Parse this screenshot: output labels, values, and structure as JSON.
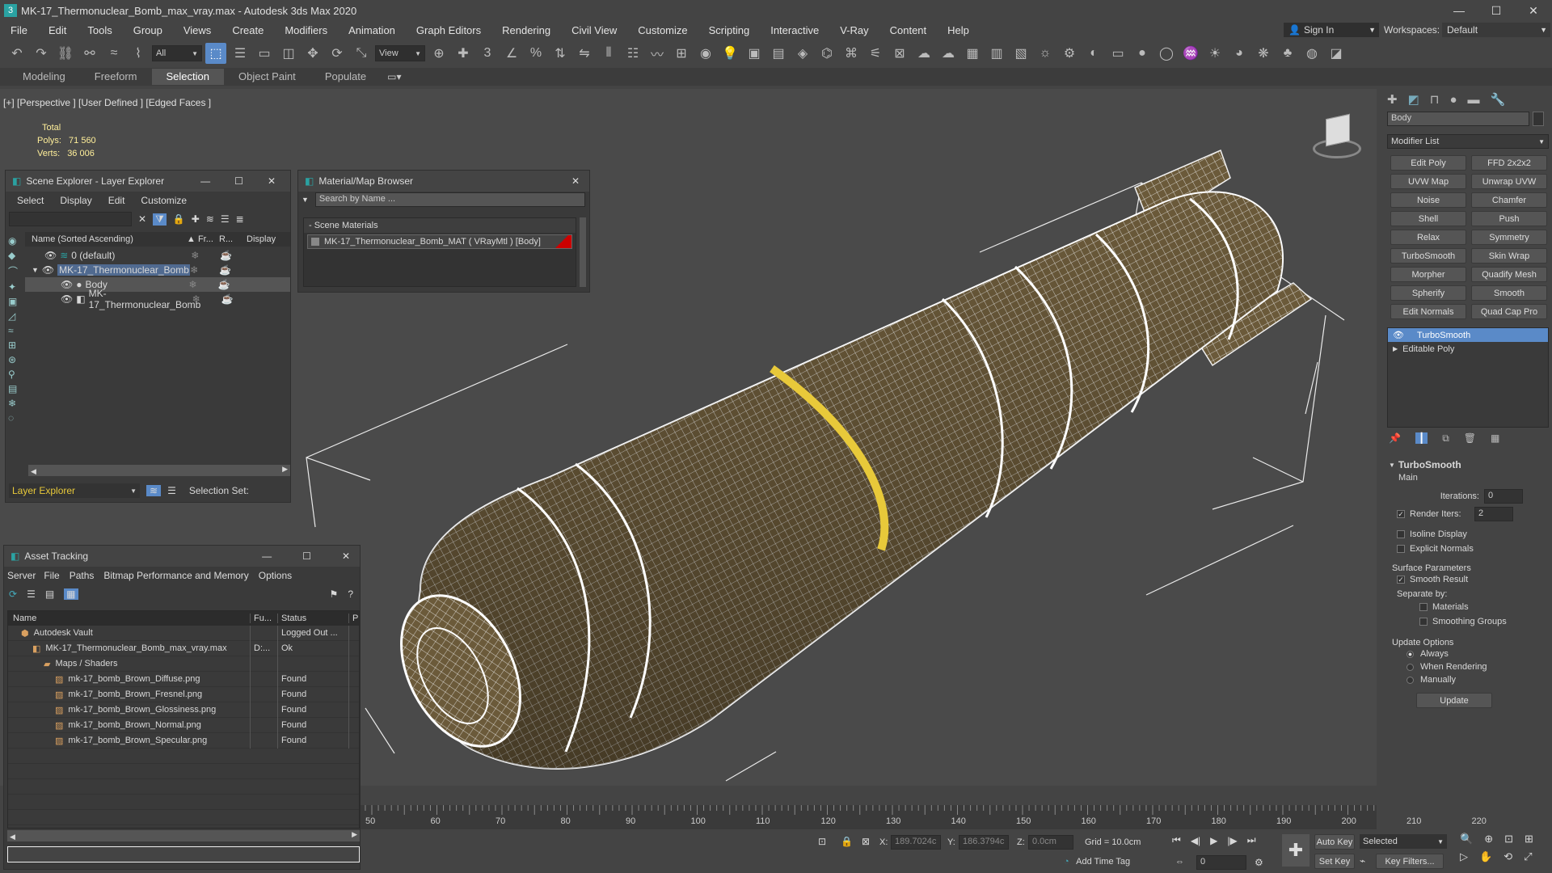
{
  "window": {
    "title": "MK-17_Thermonuclear_Bomb_max_vray.max - Autodesk 3ds Max 2020",
    "minimize": "—",
    "maximize": "☐",
    "close": "✕"
  },
  "menubar": [
    "File",
    "Edit",
    "Tools",
    "Group",
    "Views",
    "Create",
    "Modifiers",
    "Animation",
    "Graph Editors",
    "Rendering",
    "Civil View",
    "Customize",
    "Scripting",
    "Interactive",
    "V-Ray",
    "Content",
    "Help"
  ],
  "signin": "Sign In",
  "workspaces_label": "Workspaces:",
  "workspace_value": "Default",
  "toolbar": {
    "filter": "All",
    "refcoord": "View"
  },
  "ribbon_tabs": [
    "Modeling",
    "Freeform",
    "Selection",
    "Object Paint",
    "Populate"
  ],
  "ribbon_active": "Selection",
  "viewport": {
    "label": "[+] [Perspective ] [User Defined ] [Edged Faces ]",
    "stats_header": "Total",
    "polys_label": "Polys:",
    "polys_value": "71 560",
    "verts_label": "Verts:",
    "verts_value": "36 006"
  },
  "scene_explorer": {
    "title": "Scene Explorer - Layer Explorer",
    "menu": [
      "Select",
      "Display",
      "Edit",
      "Customize"
    ],
    "col_name": "Name (Sorted Ascending)",
    "col_fr": "▲ Fr...",
    "col_r": "R...",
    "col_display": "Display",
    "rows": [
      {
        "label": "0 (default)",
        "indent": 0
      },
      {
        "label": "MK-17_Thermonuclear_Bomb",
        "indent": 1
      },
      {
        "label": "Body",
        "indent": 2
      },
      {
        "label": "MK-17_Thermonuclear_Bomb",
        "indent": 2
      }
    ],
    "footer_dropdown": "Layer Explorer",
    "selection_set": "Selection Set:"
  },
  "material_browser": {
    "title": "Material/Map Browser",
    "search_placeholder": "Search by Name ...",
    "section": "- Scene Materials",
    "item": "MK-17_Thermonuclear_Bomb_MAT ( VRayMtl ) [Body]"
  },
  "asset_tracking": {
    "title": "Asset Tracking",
    "menu": [
      "Server",
      "File",
      "Paths",
      "Bitmap Performance and Memory",
      "Options"
    ],
    "col_name": "Name",
    "col_fu": "Fu...",
    "col_status": "Status",
    "col_p": "P",
    "rows": [
      {
        "name": "Autodesk Vault",
        "fu": "",
        "status": "Logged Out ..."
      },
      {
        "name": "MK-17_Thermonuclear_Bomb_max_vray.max",
        "fu": "D:...",
        "status": "Ok"
      },
      {
        "name": "Maps / Shaders",
        "fu": "",
        "status": ""
      },
      {
        "name": "mk-17_bomb_Brown_Diffuse.png",
        "fu": "",
        "status": "Found"
      },
      {
        "name": "mk-17_bomb_Brown_Fresnel.png",
        "fu": "",
        "status": "Found"
      },
      {
        "name": "mk-17_bomb_Brown_Glossiness.png",
        "fu": "",
        "status": "Found"
      },
      {
        "name": "mk-17_bomb_Brown_Normal.png",
        "fu": "",
        "status": "Found"
      },
      {
        "name": "mk-17_bomb_Brown_Specular.png",
        "fu": "",
        "status": "Found"
      }
    ]
  },
  "command_panel": {
    "object_name": "Body",
    "modifier_list": "Modifier List",
    "buttons": [
      "Edit Poly",
      "FFD 2x2x2",
      "UVW Map",
      "Unwrap UVW",
      "Noise",
      "Chamfer",
      "Shell",
      "Push",
      "Relax",
      "Symmetry",
      "TurboSmooth",
      "Skin Wrap",
      "Morpher",
      "Quadify Mesh",
      "Spherify",
      "Smooth",
      "Edit Normals",
      "Quad Cap Pro"
    ],
    "stack": [
      "TurboSmooth",
      "Editable Poly"
    ],
    "rollout_title": "TurboSmooth",
    "main_label": "Main",
    "iterations_label": "Iterations:",
    "iterations_value": "0",
    "render_iters_label": "Render Iters:",
    "render_iters_value": "2",
    "isoline": "Isoline Display",
    "explicit_normals": "Explicit Normals",
    "surface_params": "Surface Parameters",
    "smooth_result": "Smooth Result",
    "separate_by": "Separate by:",
    "materials": "Materials",
    "smoothing_groups": "Smoothing Groups",
    "update_options": "Update Options",
    "always": "Always",
    "when_rendering": "When Rendering",
    "manually": "Manually",
    "update_button": "Update"
  },
  "timeline": {
    "ticks": [
      "50",
      "60",
      "70",
      "80",
      "90",
      "100",
      "110",
      "120",
      "130",
      "140",
      "150",
      "160",
      "170",
      "180",
      "190",
      "200",
      "210",
      "220"
    ]
  },
  "statusbar": {
    "x_label": "X:",
    "x_value": "189.7024c",
    "y_label": "Y:",
    "y_value": "186.3794c",
    "z_label": "Z:",
    "z_value": "0.0cm",
    "grid": "Grid = 10.0cm",
    "add_time_tag": "Add Time Tag",
    "auto_key": "Auto Key",
    "set_key": "Set Key",
    "selected": "Selected",
    "key_filters": "Key Filters...",
    "frame": "0"
  },
  "colors": {
    "accent": "#5a8ac8",
    "wire": "#ffffff",
    "mesh": "#6b5a3a",
    "highlight": "#e8c93a"
  }
}
